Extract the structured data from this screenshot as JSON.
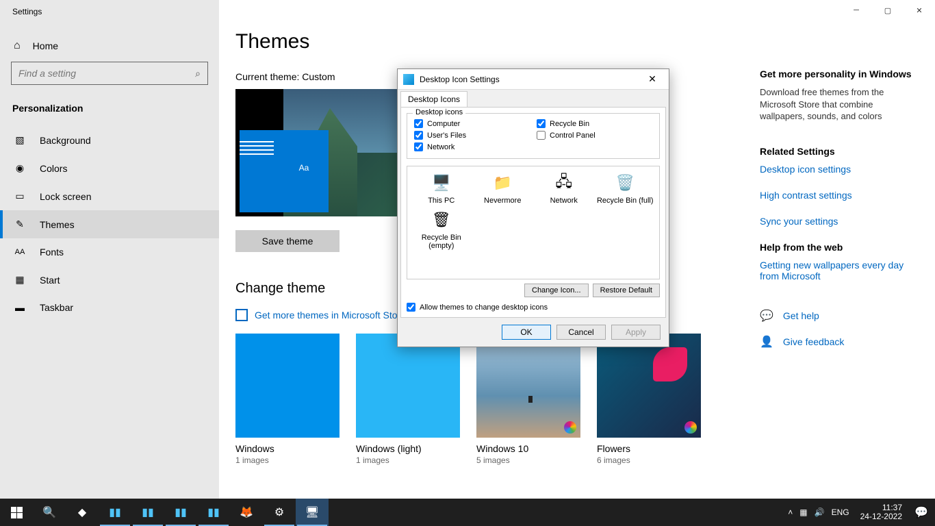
{
  "window": {
    "title": "Settings"
  },
  "sidebar": {
    "home": "Home",
    "search_placeholder": "Find a setting",
    "section": "Personalization",
    "items": [
      {
        "label": "Background"
      },
      {
        "label": "Colors"
      },
      {
        "label": "Lock screen"
      },
      {
        "label": "Themes"
      },
      {
        "label": "Fonts"
      },
      {
        "label": "Start"
      },
      {
        "label": "Taskbar"
      }
    ]
  },
  "main": {
    "title": "Themes",
    "current_theme_label": "Current theme: Custom",
    "preview_aa": "Aa",
    "save_theme": "Save theme",
    "change_theme": "Change theme",
    "store_link": "Get more themes in Microsoft Store",
    "themes": [
      {
        "name": "Windows",
        "sub": "1 images"
      },
      {
        "name": "Windows (light)",
        "sub": "1 images"
      },
      {
        "name": "Windows 10",
        "sub": "5 images"
      },
      {
        "name": "Flowers",
        "sub": "6 images"
      }
    ]
  },
  "rightpane": {
    "hdr1": "Get more personality in Windows",
    "txt1": "Download free themes from the Microsoft Store that combine wallpapers, sounds, and colors",
    "hdr2": "Related Settings",
    "link1": "Desktop icon settings",
    "link2": "High contrast settings",
    "link3": "Sync your settings",
    "hdr3": "Help from the web",
    "link4": "Getting new wallpapers every day from Microsoft",
    "help": "Get help",
    "feedback": "Give feedback"
  },
  "dialog": {
    "title": "Desktop Icon Settings",
    "tab": "Desktop Icons",
    "legend": "Desktop icons",
    "checks": {
      "computer": "Computer",
      "recycle": "Recycle Bin",
      "users": "User's Files",
      "control": "Control Panel",
      "network": "Network"
    },
    "icons": {
      "thispc": "This PC",
      "nevermore": "Nevermore",
      "network": "Network",
      "rbfull": "Recycle Bin (full)",
      "rbempty": "Recycle Bin (empty)"
    },
    "change_icon": "Change Icon...",
    "restore": "Restore Default",
    "allow": "Allow themes to change desktop icons",
    "ok": "OK",
    "cancel": "Cancel",
    "apply": "Apply"
  },
  "taskbar": {
    "lang": "ENG",
    "time": "11:37",
    "date": "24-12-2022"
  }
}
